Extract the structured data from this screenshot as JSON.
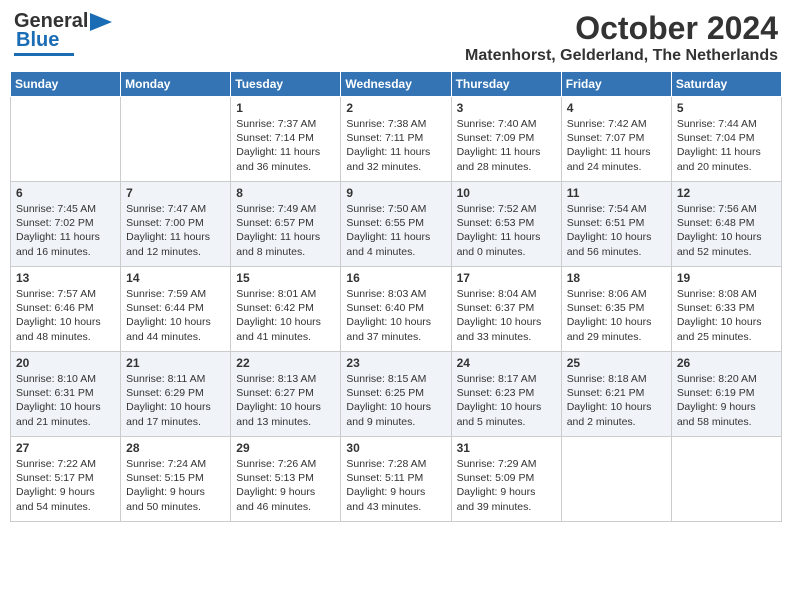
{
  "header": {
    "logo_general": "General",
    "logo_blue": "Blue",
    "month": "October 2024",
    "location": "Matenhorst, Gelderland, The Netherlands"
  },
  "weekdays": [
    "Sunday",
    "Monday",
    "Tuesday",
    "Wednesday",
    "Thursday",
    "Friday",
    "Saturday"
  ],
  "rows": [
    [
      {
        "day": "",
        "info": ""
      },
      {
        "day": "",
        "info": ""
      },
      {
        "day": "1",
        "info": "Sunrise: 7:37 AM\nSunset: 7:14 PM\nDaylight: 11 hours\nand 36 minutes."
      },
      {
        "day": "2",
        "info": "Sunrise: 7:38 AM\nSunset: 7:11 PM\nDaylight: 11 hours\nand 32 minutes."
      },
      {
        "day": "3",
        "info": "Sunrise: 7:40 AM\nSunset: 7:09 PM\nDaylight: 11 hours\nand 28 minutes."
      },
      {
        "day": "4",
        "info": "Sunrise: 7:42 AM\nSunset: 7:07 PM\nDaylight: 11 hours\nand 24 minutes."
      },
      {
        "day": "5",
        "info": "Sunrise: 7:44 AM\nSunset: 7:04 PM\nDaylight: 11 hours\nand 20 minutes."
      }
    ],
    [
      {
        "day": "6",
        "info": "Sunrise: 7:45 AM\nSunset: 7:02 PM\nDaylight: 11 hours\nand 16 minutes."
      },
      {
        "day": "7",
        "info": "Sunrise: 7:47 AM\nSunset: 7:00 PM\nDaylight: 11 hours\nand 12 minutes."
      },
      {
        "day": "8",
        "info": "Sunrise: 7:49 AM\nSunset: 6:57 PM\nDaylight: 11 hours\nand 8 minutes."
      },
      {
        "day": "9",
        "info": "Sunrise: 7:50 AM\nSunset: 6:55 PM\nDaylight: 11 hours\nand 4 minutes."
      },
      {
        "day": "10",
        "info": "Sunrise: 7:52 AM\nSunset: 6:53 PM\nDaylight: 11 hours\nand 0 minutes."
      },
      {
        "day": "11",
        "info": "Sunrise: 7:54 AM\nSunset: 6:51 PM\nDaylight: 10 hours\nand 56 minutes."
      },
      {
        "day": "12",
        "info": "Sunrise: 7:56 AM\nSunset: 6:48 PM\nDaylight: 10 hours\nand 52 minutes."
      }
    ],
    [
      {
        "day": "13",
        "info": "Sunrise: 7:57 AM\nSunset: 6:46 PM\nDaylight: 10 hours\nand 48 minutes."
      },
      {
        "day": "14",
        "info": "Sunrise: 7:59 AM\nSunset: 6:44 PM\nDaylight: 10 hours\nand 44 minutes."
      },
      {
        "day": "15",
        "info": "Sunrise: 8:01 AM\nSunset: 6:42 PM\nDaylight: 10 hours\nand 41 minutes."
      },
      {
        "day": "16",
        "info": "Sunrise: 8:03 AM\nSunset: 6:40 PM\nDaylight: 10 hours\nand 37 minutes."
      },
      {
        "day": "17",
        "info": "Sunrise: 8:04 AM\nSunset: 6:37 PM\nDaylight: 10 hours\nand 33 minutes."
      },
      {
        "day": "18",
        "info": "Sunrise: 8:06 AM\nSunset: 6:35 PM\nDaylight: 10 hours\nand 29 minutes."
      },
      {
        "day": "19",
        "info": "Sunrise: 8:08 AM\nSunset: 6:33 PM\nDaylight: 10 hours\nand 25 minutes."
      }
    ],
    [
      {
        "day": "20",
        "info": "Sunrise: 8:10 AM\nSunset: 6:31 PM\nDaylight: 10 hours\nand 21 minutes."
      },
      {
        "day": "21",
        "info": "Sunrise: 8:11 AM\nSunset: 6:29 PM\nDaylight: 10 hours\nand 17 minutes."
      },
      {
        "day": "22",
        "info": "Sunrise: 8:13 AM\nSunset: 6:27 PM\nDaylight: 10 hours\nand 13 minutes."
      },
      {
        "day": "23",
        "info": "Sunrise: 8:15 AM\nSunset: 6:25 PM\nDaylight: 10 hours\nand 9 minutes."
      },
      {
        "day": "24",
        "info": "Sunrise: 8:17 AM\nSunset: 6:23 PM\nDaylight: 10 hours\nand 5 minutes."
      },
      {
        "day": "25",
        "info": "Sunrise: 8:18 AM\nSunset: 6:21 PM\nDaylight: 10 hours\nand 2 minutes."
      },
      {
        "day": "26",
        "info": "Sunrise: 8:20 AM\nSunset: 6:19 PM\nDaylight: 9 hours\nand 58 minutes."
      }
    ],
    [
      {
        "day": "27",
        "info": "Sunrise: 7:22 AM\nSunset: 5:17 PM\nDaylight: 9 hours\nand 54 minutes."
      },
      {
        "day": "28",
        "info": "Sunrise: 7:24 AM\nSunset: 5:15 PM\nDaylight: 9 hours\nand 50 minutes."
      },
      {
        "day": "29",
        "info": "Sunrise: 7:26 AM\nSunset: 5:13 PM\nDaylight: 9 hours\nand 46 minutes."
      },
      {
        "day": "30",
        "info": "Sunrise: 7:28 AM\nSunset: 5:11 PM\nDaylight: 9 hours\nand 43 minutes."
      },
      {
        "day": "31",
        "info": "Sunrise: 7:29 AM\nSunset: 5:09 PM\nDaylight: 9 hours\nand 39 minutes."
      },
      {
        "day": "",
        "info": ""
      },
      {
        "day": "",
        "info": ""
      }
    ]
  ]
}
